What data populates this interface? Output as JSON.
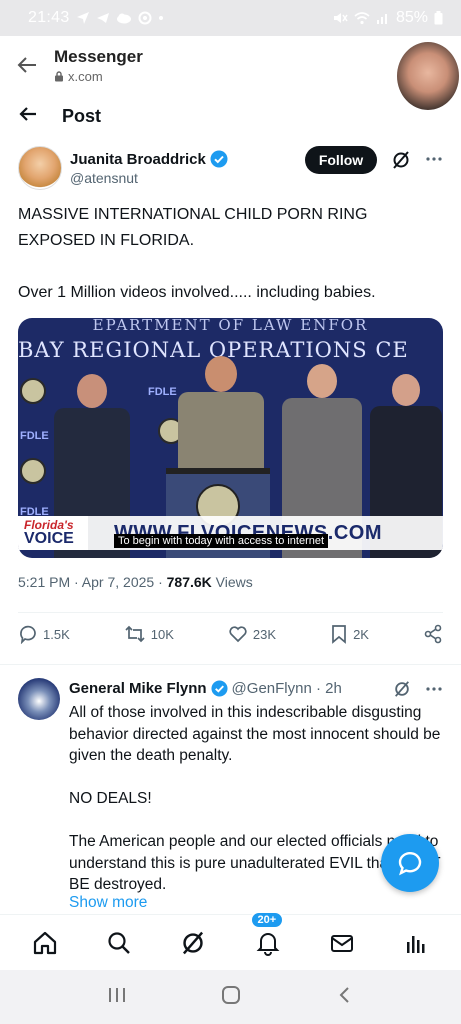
{
  "status_bar": {
    "time": "21:43",
    "battery": "85%"
  },
  "browser": {
    "title": "Messenger",
    "url": "x.com"
  },
  "post_header": {
    "title": "Post"
  },
  "tweet": {
    "author_name": "Juanita Broaddrick",
    "author_handle": "@atensnut",
    "follow_label": "Follow",
    "text_line1": "MASSIVE INTERNATIONAL CHILD PORN RING EXPOSED IN FLORIDA.",
    "text_line2": "Over 1 Million videos involved..... including babies.",
    "media": {
      "banner_top": "EPARTMENT OF LAW ENFOR",
      "banner_main": "BAY REGIONAL OPERATIONS CE",
      "fdle": "FDLE",
      "logo_top": "Florida's",
      "logo_bottom": "VOICE",
      "url_text": "WWW.FLVOICENEWS.COM",
      "caption": "To begin with today with access to internet"
    },
    "timestamp": "5:21 PM · Apr 7, 2025 · ",
    "views_count": "787.6K",
    "views_label": " Views",
    "replies": "1.5K",
    "reposts": "10K",
    "likes": "23K",
    "bookmarks": "2K"
  },
  "reply": {
    "name": "General Mike Flynn",
    "handle": "@GenFlynn · 2h",
    "p1": "All of those involved in this indescribable disgusting behavior directed against the most innocent should be given the death penalty.",
    "p2": "NO DEALS!",
    "p3": "The American people and our elected officials need to understand this is pure unadulterated EVIL that MUST BE destroyed.",
    "show_more": "Show more"
  },
  "bottom_nav": {
    "notifications_badge": "20+"
  },
  "colors": {
    "accent": "#1d9bf0",
    "text": "#0f1419",
    "secondary": "#536471"
  }
}
